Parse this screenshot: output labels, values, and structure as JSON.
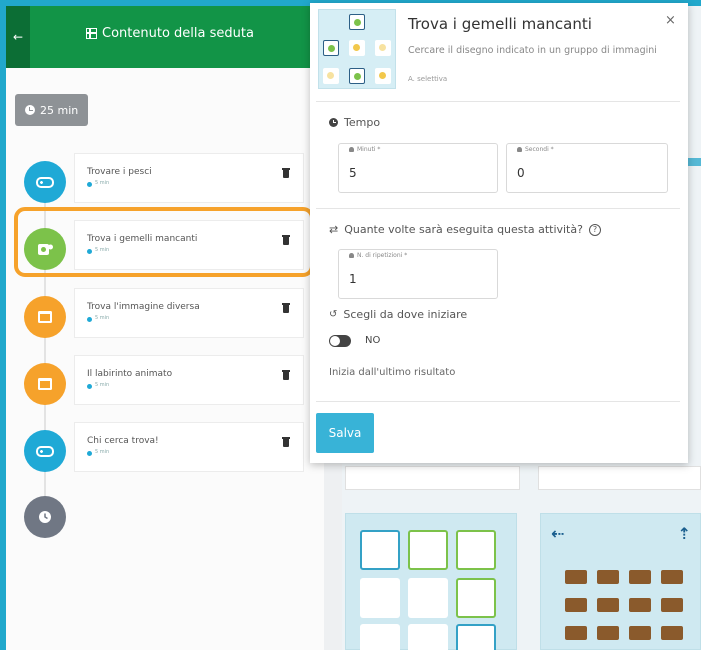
{
  "header": {
    "back_icon": "arrow-left-icon",
    "title": "Contenuto della seduta"
  },
  "duration": "25 min",
  "activities": [
    {
      "name": "Trovare i pesci",
      "minutes": "5 min",
      "icon": "gamepad-icon",
      "color": "#1fa9d6"
    },
    {
      "name": "Trova i gemelli mancanti",
      "minutes": "5 min",
      "icon": "puzzle-icon",
      "color": "#7cc24a",
      "highlighted": true
    },
    {
      "name": "Trova l'immagine diversa",
      "minutes": "5 min",
      "icon": "window-icon",
      "color": "#f6a22b"
    },
    {
      "name": "Il labirinto animato",
      "minutes": "5 min",
      "icon": "window-icon",
      "color": "#f6a22b"
    },
    {
      "name": "Chi cerca trova!",
      "minutes": "5 min",
      "icon": "gamepad-icon",
      "color": "#1fa9d6"
    }
  ],
  "end_icon": "clock-icon",
  "modal": {
    "title": "Trova i gemelli mancanti",
    "description": "Cercare il disegno indicato in un gruppo di immagini",
    "tag": "A. selettiva",
    "close": "×",
    "time_section": "Tempo",
    "minutes_label": "Minuti *",
    "minutes_value": "5",
    "seconds_label": "Secondi *",
    "seconds_value": "0",
    "repeat_question": "Quante volte sarà eseguita questa attività?",
    "repetitions_label": "N. di ripetizioni *",
    "repetitions_value": "1",
    "start_question": "Scegli da dove iniziare",
    "toggle_value": "NO",
    "hint": "Inizia dall'ultimo risultato",
    "save": "Salva"
  },
  "colors": {
    "header_green": "#129447",
    "accent_blue": "#38b3d7",
    "highlight_orange": "#f6a22b"
  }
}
